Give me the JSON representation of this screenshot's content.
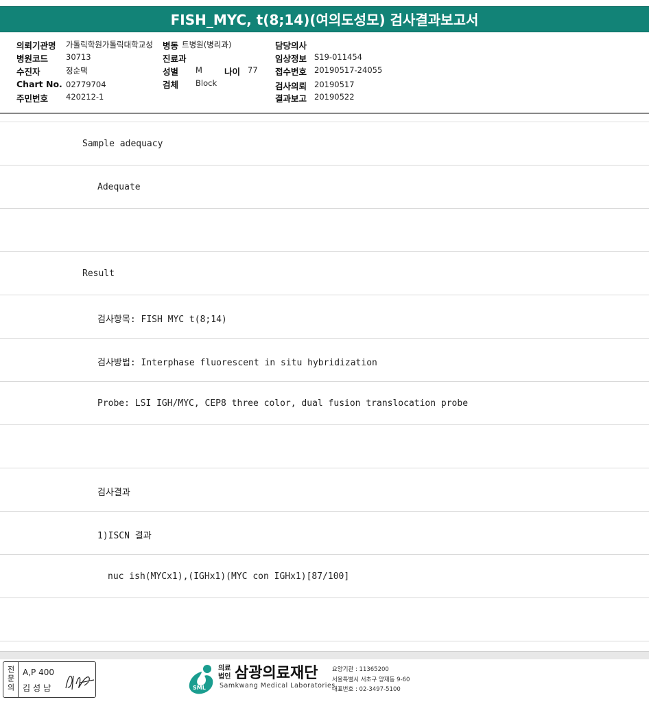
{
  "report": {
    "title": "FISH_MYC, t(8;14)(여의도성모) 검사결과보고서"
  },
  "header": {
    "institution_label": "의뢰기관명",
    "institution_value": "가톨릭학원가톨릭대학교성",
    "ward_label": "병동",
    "ward_value": "트병원(병리과)",
    "doctor_label": "담당의사",
    "doctor_value": "",
    "hospital_code_label": "병원코드",
    "hospital_code_value": "30713",
    "dept_label": "진료과",
    "dept_value": "",
    "clinical_info_label": "임상정보",
    "clinical_info_value": "S19-011454",
    "patient_label": "수진자",
    "patient_value": "정순택",
    "sex_label": "성별",
    "sex_value": "M",
    "age_label": "나이",
    "age_value": "77",
    "receipt_no_label": "접수번호",
    "receipt_no_value": "20190517-24055",
    "chart_no_label": "Chart No.",
    "chart_no_value": "02779704",
    "specimen_label": "검체",
    "specimen_value": "Block",
    "request_label": "검사의뢰",
    "request_value": "20190517",
    "id_no_label": "주민번호",
    "id_no_value": "420212-1",
    "report_label": "결과보고",
    "report_value": "20190522"
  },
  "rows": [
    {
      "text": "Sample adequacy",
      "indent": "l1"
    },
    {
      "text": "Adequate",
      "indent": "l2"
    },
    {
      "text": "",
      "indent": "l1"
    },
    {
      "text": "Result",
      "indent": "l1"
    },
    {
      "text": "검사항목: FISH MYC t(8;14)",
      "indent": "l2"
    },
    {
      "text": "검사방법: Interphase fluorescent in situ hybridization",
      "indent": "l2"
    },
    {
      "text": "Probe: LSI IGH/MYC, CEP8 three color, dual fusion translocation probe",
      "indent": "l2"
    },
    {
      "text": "",
      "indent": "l1"
    },
    {
      "text": "검사결과",
      "indent": "l2"
    },
    {
      "text": "1)ISCN 결과",
      "indent": "l2"
    },
    {
      "text": "nuc ish(MYCx1),(IGHx1)(MYC con IGHx1)[87/100]",
      "indent": "l3"
    },
    {
      "text": "",
      "indent": "l1"
    }
  ],
  "signature": {
    "side_label": "전문의",
    "line1": "A,P 400",
    "line2": "김성남"
  },
  "footer": {
    "org_tag_line1": "의료",
    "org_tag_line2": "법인",
    "org_name": "삼광의료재단",
    "org_eng": "Samkwang Medical Laboratories",
    "badge": "SML",
    "info1": "요양기관 : 11365200",
    "info2": "서울특별시 서초구 양재동 9-60",
    "info3": "대표번호 : 02-3497-5100",
    "colors": {
      "primary": "#128377",
      "logo": "#1a9d8f"
    }
  }
}
